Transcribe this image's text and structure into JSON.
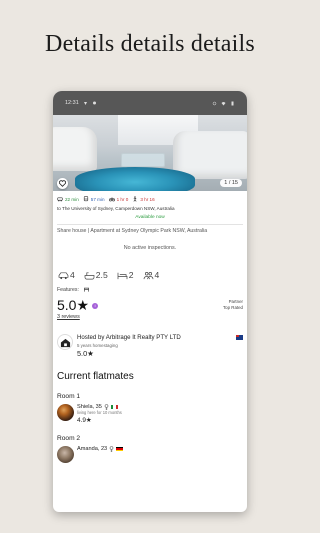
{
  "headline": "Details details details",
  "status_bar": {
    "time": "12:31"
  },
  "photo": {
    "counter": "1 / 15"
  },
  "commute": [
    {
      "icon": "car-icon",
      "time": "22 min",
      "color": "#2a8a3b"
    },
    {
      "icon": "bus-icon",
      "time": "57 min",
      "color": "#2c5fb0"
    },
    {
      "icon": "bike-icon",
      "time": "1 hr 0",
      "color": "#c53030"
    },
    {
      "icon": "walk-icon",
      "time": "3 hr 16",
      "color": "#c53030"
    }
  ],
  "destination": "to The University of Sydney, Camperdown NSW, Australia",
  "availability": "Available now",
  "listing_type": "Share house | Apartment at Sydney Olympic Park NSW, Australia",
  "inspections": "No active inspections.",
  "facts": {
    "parking": "4",
    "baths": "2.5",
    "beds": "2",
    "flatmates": "4"
  },
  "features_label": "Features:",
  "rating": {
    "score": "5.0★",
    "reviews": "3 reviews",
    "badge_1": "Partner",
    "badge_2": "Top Rated"
  },
  "host": {
    "name": "Hosted by Arbitrage It Realty PTY LTD",
    "years": "5 years homestaging",
    "score": "5.0★"
  },
  "flatmates_title": "Current flatmates",
  "rooms": [
    {
      "label": "Room 1",
      "name": "Shiela, 35",
      "sub": "living here for 10 months",
      "score": "4.9★",
      "flag": "it"
    },
    {
      "label": "Room 2",
      "name": "Amanda, 23",
      "sub": "",
      "score": "",
      "flag": "de"
    }
  ],
  "colors": {
    "available": "#2d9d41",
    "rating_info": "#a561d8",
    "status_bar": "#575757"
  }
}
